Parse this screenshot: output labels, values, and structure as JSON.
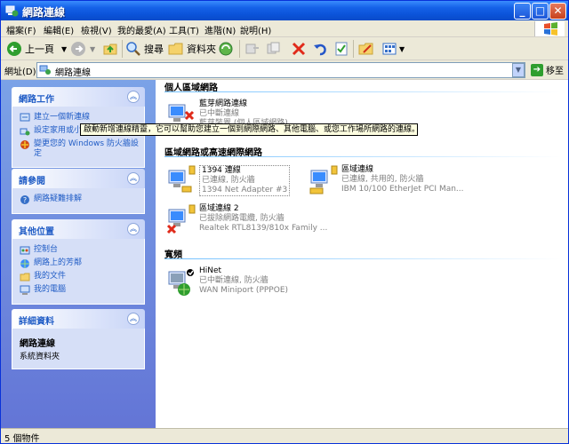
{
  "window": {
    "title": "網路連線"
  },
  "menu": [
    "檔案(F)",
    "編輯(E)",
    "檢視(V)",
    "我的最愛(A)",
    "工具(T)",
    "進階(N)",
    "說明(H)"
  ],
  "toolbar": {
    "back_label": "上一頁",
    "search_label": "搜尋",
    "folders_label": "資料夾"
  },
  "address": {
    "label": "網址(D)",
    "value": "網路連線",
    "go_label": "移至"
  },
  "left": {
    "network_tasks": {
      "title": "網路工作",
      "items": [
        "建立一個新連線",
        "設定家用或小型辦公室網路",
        "變更您的 Windows 防火牆設定"
      ]
    },
    "see_also": {
      "title": "請參閱",
      "items": [
        "網路疑難排解"
      ]
    },
    "other_places": {
      "title": "其他位置",
      "items": [
        "控制台",
        "網路上的芳鄰",
        "我的文件",
        "我的電腦"
      ]
    },
    "details": {
      "title": "詳細資料",
      "name": "網路連線",
      "type": "系統資料夾"
    }
  },
  "groups": {
    "personal": {
      "title": "個人區域網路",
      "items": [
        {
          "name": "藍芽網路連線",
          "status": "已中斷連線",
          "device": "藍芽裝置 (個人區域網路)"
        }
      ]
    },
    "lan": {
      "title": "區域網路或高速網際網路",
      "items": [
        {
          "name": "1394 連線",
          "status": "已連線, 防火牆",
          "device": "1394 Net Adapter #3"
        },
        {
          "name": "區域連線",
          "status": "已連線, 共用的, 防火牆",
          "device": "IBM 10/100 EtherJet PCI Man..."
        },
        {
          "name": "區域連線 2",
          "status": "已拔除網路電纜, 防火牆",
          "device": "Realtek RTL8139/810x Family ..."
        }
      ]
    },
    "broadband": {
      "title": "寬頻",
      "items": [
        {
          "name": "HiNet",
          "status": "已中斷連線, 防火牆",
          "device": "WAN Miniport (PPPOE)"
        }
      ]
    }
  },
  "tooltip": "啟動新增連線精靈，它可以幫助您建立一個到網際網路、其他電腦、或您工作場所網路的連線。",
  "status": "5 個物件"
}
